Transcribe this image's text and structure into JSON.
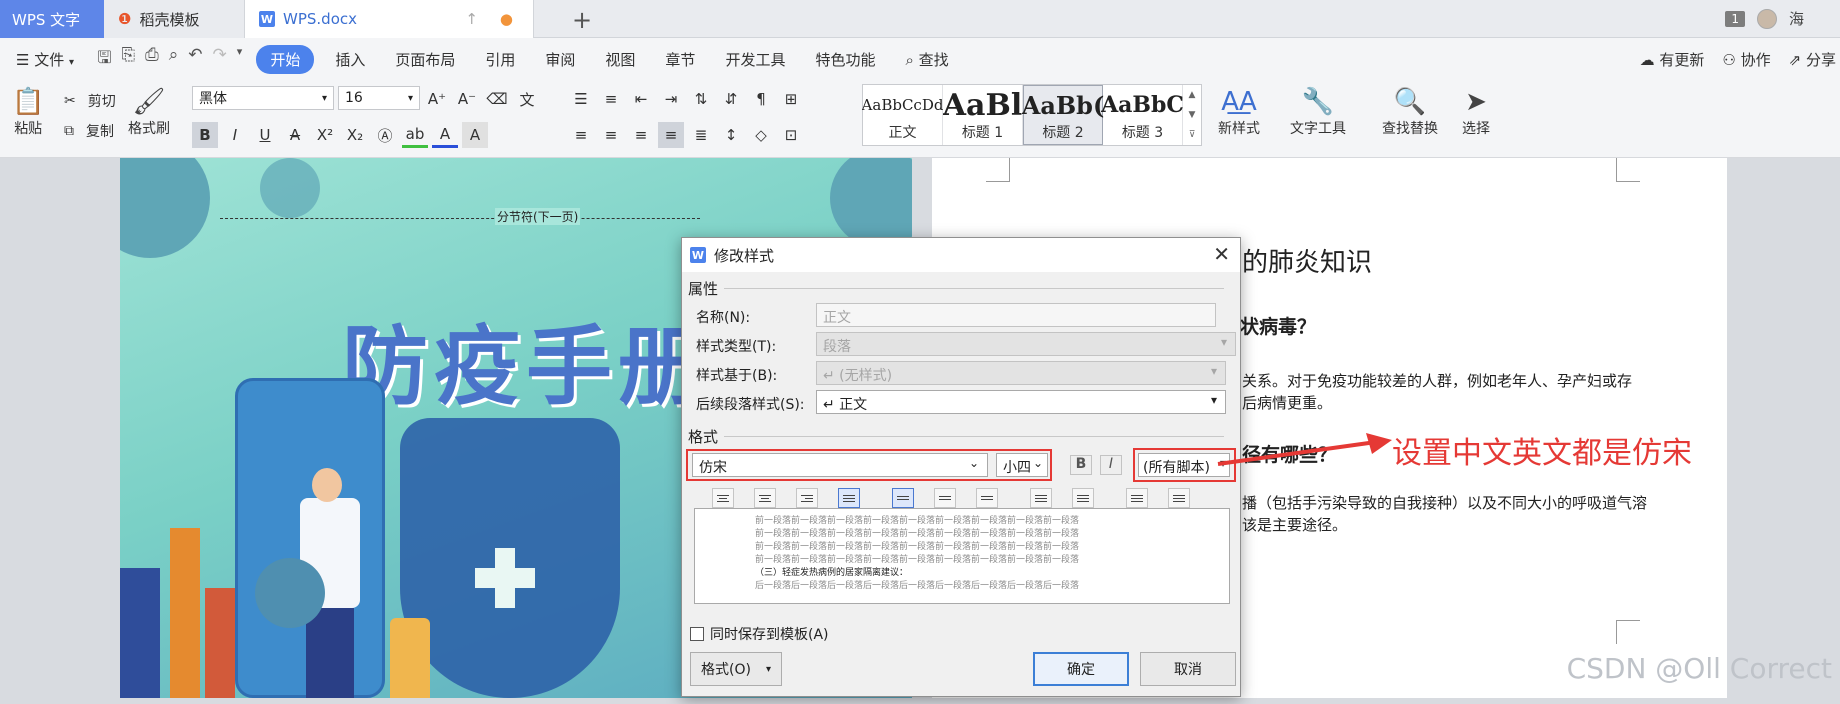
{
  "titlebar": {
    "app_tab": "WPS 文字",
    "template_tab": "稻壳模板",
    "doc_tab": "WPS.docx",
    "user_badge": "1",
    "user_name": "海"
  },
  "menu": {
    "file": "文件",
    "items": [
      "开始",
      "插入",
      "页面布局",
      "引用",
      "审阅",
      "视图",
      "章节",
      "开发工具",
      "特色功能"
    ],
    "search": "查找",
    "right": [
      "有更新",
      "协作",
      "分享"
    ]
  },
  "toolbar": {
    "paste": "粘贴",
    "cut": "剪切",
    "copy": "复制",
    "format_painter": "格式刷",
    "font_name": "黑体",
    "font_size": "16",
    "styles": [
      {
        "preview": "AaBbCcDd",
        "label": "正文"
      },
      {
        "preview": "AaBl",
        "label": "标题 1"
      },
      {
        "preview": "AaBb(",
        "label": "标题 2"
      },
      {
        "preview": "AaBbC",
        "label": "标题 3"
      }
    ],
    "new_style": "新样式",
    "text_tools": "文字工具",
    "find_replace": "查找替换",
    "select": "选择"
  },
  "cover": {
    "section_break": "分节符(下一页)",
    "title": "防疫手册"
  },
  "page": {
    "heading": "的肺炎知识",
    "q1": "状病毒？",
    "p1a": "关系。对于免疫功能较差的人群，例如老年人、孕产妇或存",
    "p1b": "后病情更重。",
    "q2": "径有哪些？",
    "p2a": "播（包括手污染导致的自我接种）以及不同大小的呼吸道气溶",
    "p2b": "该是主要途径。"
  },
  "dialog": {
    "title": "修改样式",
    "section_props": "属性",
    "name_label": "名称(N):",
    "name_value": "正文",
    "type_label": "样式类型(T):",
    "type_value": "段落",
    "based_label": "样式基于(B):",
    "based_value": "↵ (无样式)",
    "next_label": "后续段落样式(S):",
    "next_value": "↵ 正文",
    "section_format": "格式",
    "font_value": "仿宋",
    "size_value": "小四",
    "bold": "B",
    "italic": "I",
    "script_value": "(所有脚本)",
    "preview_before": "前一段落前一段落前一段落前一段落前一段落前一段落前一段落前一段落前一段落",
    "preview_current": "（三）轻症发热病例的居家隔离建议：",
    "preview_after": "后一段落后一段落后一段落后一段落后一段落后一段落后一段落后一段落后一段落",
    "save_template": "同时保存到模板(A)",
    "format_button": "格式(O)",
    "ok": "确定",
    "cancel": "取消"
  },
  "annotation": "设置中文英文都是仿宋",
  "watermark": "CSDN @Oll Correct",
  "colors": {
    "accent": "#4c82ec",
    "annotation_red": "#e53935",
    "cover_teal": "#7ad0c6",
    "title_blue": "#4a74c9"
  }
}
